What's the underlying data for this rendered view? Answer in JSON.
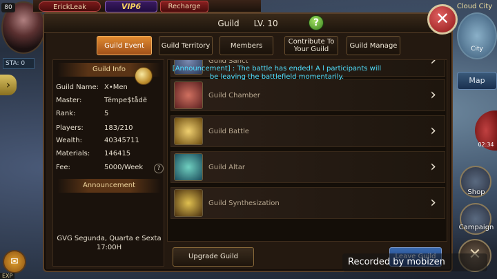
{
  "hud": {
    "level": "80",
    "player_name": "ErickLeak",
    "vip": "VIP6",
    "recharge": "Recharge",
    "sta": "STA: 0",
    "exp": "EXP"
  },
  "right_menu": {
    "city_label": "Cloud City",
    "city_sub": "City",
    "map": "Map",
    "timer": "02:34",
    "shop": "Shop",
    "campaign": "Campaign"
  },
  "dialog": {
    "title": "Guild",
    "level": "LV. 10",
    "help": "?",
    "close": "✕"
  },
  "tabs": [
    {
      "label": "Guild Event",
      "active": true
    },
    {
      "label": "Guild Territory",
      "active": false
    },
    {
      "label": "Members",
      "active": false
    },
    {
      "label": "Contribute To Your Guild",
      "active": false
    },
    {
      "label": "Guild Manage",
      "active": false
    }
  ],
  "guild_info": {
    "header": "Guild Info",
    "rows": [
      {
        "label": "Guild Name:",
        "value": "X•Men"
      },
      {
        "label": "Master:",
        "value": "Tëmpe$tådë"
      },
      {
        "label": "Rank:",
        "value": "5"
      },
      {
        "label": "Players:",
        "value": "183/210"
      },
      {
        "label": "Wealth:",
        "value": "40345711"
      },
      {
        "label": "Materials:",
        "value": "146415"
      },
      {
        "label": "Fee:",
        "value": "5000/Week"
      }
    ],
    "announcement_header": "Announcement",
    "announcement_text": "GVG Segunda, Quarta e Sexta 17:00H"
  },
  "broadcast": "[Announcement] : The battle has ended! A l participants will be leaving the battlefield momentarily.",
  "events": [
    {
      "label": "Guild Sanct",
      "icon": "sanctuary-icon",
      "color": "#3a4a6a"
    },
    {
      "label": "Guild Chamber",
      "icon": "chamber-icon",
      "color": "#6a3a3a"
    },
    {
      "label": "Guild Battle",
      "icon": "battle-icon",
      "color": "#5a4a1a"
    },
    {
      "label": "Guild Altar",
      "icon": "altar-icon",
      "color": "#2a4a5a"
    },
    {
      "label": "Guild Synthesization",
      "icon": "synthesis-icon",
      "color": "#4a3a1a"
    }
  ],
  "buttons": {
    "upgrade": "Upgrade Guild",
    "leave": "Leave Guild"
  },
  "watermark": "Recorded by mobizen",
  "colors": {
    "accent_orange": "#e08a30",
    "broadcast_cyan": "#50e0ff",
    "close_red": "#c03030",
    "help_green": "#5aa030"
  }
}
